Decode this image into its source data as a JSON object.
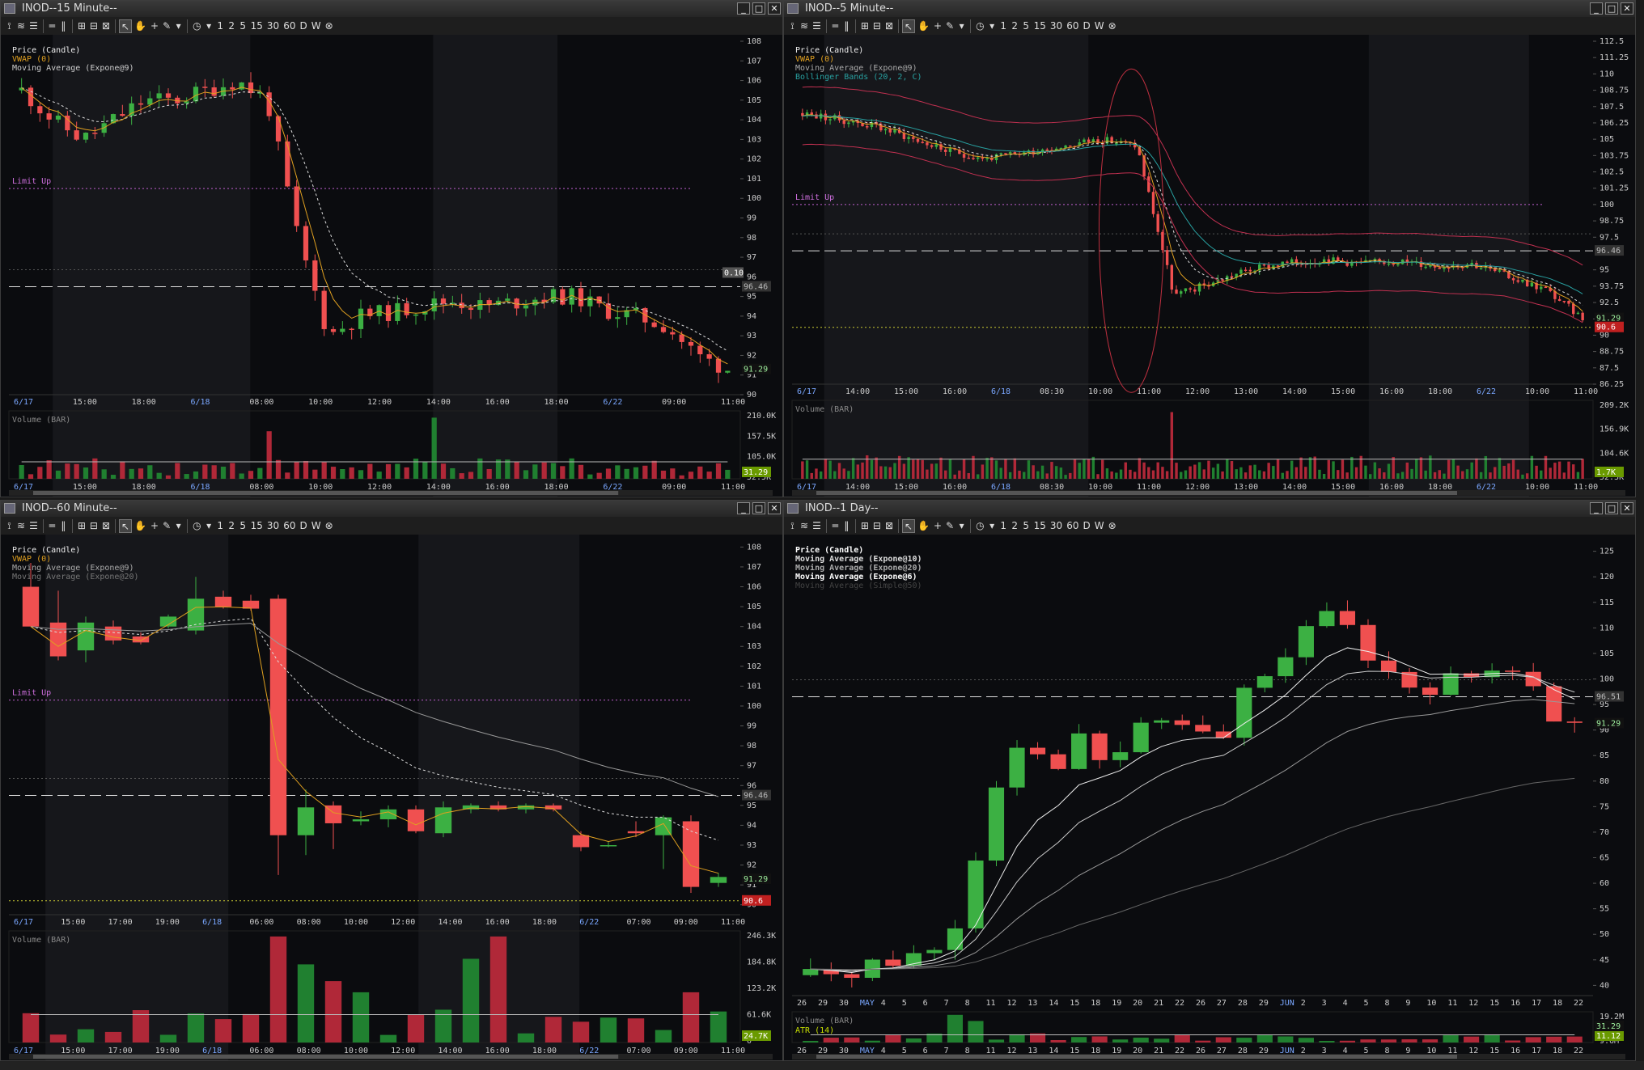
{
  "windows": [
    {
      "id": "w15",
      "title": "INOD--15 Minute--",
      "labels": [
        "Price (Candle)",
        "VWAP (0)",
        "Moving Average (Expone@9)"
      ],
      "limit_label": "Limit Up",
      "y_ticks": [
        "108",
        "107",
        "106",
        "105",
        "104",
        "103",
        "102",
        "101",
        "100",
        "99",
        "98",
        "97",
        "96",
        "95",
        "94",
        "93",
        "92",
        "91",
        "90"
      ],
      "x_ticks": [
        "6/17",
        "15:00",
        "18:00",
        "6/18",
        "08:00",
        "10:00",
        "12:00",
        "14:00",
        "16:00",
        "18:00",
        "6/22",
        "09:00",
        "11:00"
      ],
      "vol_label": "Volume (BAR)",
      "vol_ticks": [
        "210.0K",
        "157.5K",
        "105.0K",
        "52.5K"
      ],
      "badges": {
        "last": "91.29",
        "ref": "96.46",
        "crosshair": "0.10",
        "vol": "31.29"
      }
    },
    {
      "id": "w5",
      "title": "INOD--5 Minute--",
      "labels": [
        "Price (Candle)",
        "VWAP (0)",
        "Moving Average (Expone@9)",
        "Bollinger Bands (20, 2, C)"
      ],
      "limit_label": "Limit Up",
      "y_ticks": [
        "112.5",
        "111.25",
        "110",
        "108.75",
        "107.5",
        "106.25",
        "105",
        "103.75",
        "102.5",
        "101.25",
        "100",
        "98.75",
        "97.5",
        "95",
        "93.75",
        "92.5",
        "91.25",
        "90",
        "88.75",
        "87.5",
        "86.25"
      ],
      "x_ticks": [
        "6/17",
        "14:00",
        "15:00",
        "16:00",
        "6/18",
        "08:30",
        "10:00",
        "11:00",
        "12:00",
        "13:00",
        "14:00",
        "15:00",
        "16:00",
        "18:00",
        "6/22",
        "10:00",
        "11:00"
      ],
      "vol_label": "Volume (BAR)",
      "vol_ticks": [
        "209.2K",
        "156.9K",
        "104.6K",
        "52.3K"
      ],
      "badges": {
        "last": "91.29",
        "ref": "96.46",
        "low": "90.6",
        "vol": "1.7K"
      }
    },
    {
      "id": "w60",
      "title": "INOD--60 Minute--",
      "labels": [
        "Price (Candle)",
        "VWAP (0)",
        "Moving Average (Expone@9)",
        "Moving Average (Expone@20)"
      ],
      "limit_label": "Limit Up",
      "y_ticks": [
        "108",
        "107",
        "106",
        "105",
        "104",
        "103",
        "102",
        "101",
        "100",
        "99",
        "98",
        "97",
        "96",
        "95",
        "94",
        "93",
        "92",
        "91",
        "90"
      ],
      "x_ticks": [
        "6/17",
        "15:00",
        "17:00",
        "19:00",
        "6/18",
        "06:00",
        "08:00",
        "10:00",
        "12:00",
        "14:00",
        "16:00",
        "18:00",
        "6/22",
        "07:00",
        "09:00",
        "11:00"
      ],
      "vol_label": "Volume (BAR)",
      "vol_ticks": [
        "246.3K",
        "184.8K",
        "123.2K",
        "61.6K",
        "0"
      ],
      "badges": {
        "last": "91.29",
        "ref": "96.46",
        "low": "90.6",
        "vol": "24.7K"
      }
    },
    {
      "id": "wd",
      "title": "INOD--1 Day--",
      "labels": [
        "Price (Candle)",
        "Moving Average (Expone@10)",
        "Moving Average (Expone@20)",
        "Moving Average (Expone@6)",
        "Moving Average (Simple@50)"
      ],
      "y_ticks": [
        "125",
        "120",
        "115",
        "110",
        "105",
        "100",
        "95",
        "90",
        "85",
        "80",
        "75",
        "70",
        "65",
        "60",
        "55",
        "50",
        "45",
        "40"
      ],
      "x_ticks": [
        "26",
        "29",
        "30",
        "MAY",
        "4",
        "5",
        "6",
        "7",
        "8",
        "11",
        "12",
        "13",
        "14",
        "15",
        "18",
        "19",
        "20",
        "21",
        "22",
        "26",
        "27",
        "28",
        "29",
        "JUN",
        "2",
        "3",
        "4",
        "5",
        "8",
        "9",
        "10",
        "11",
        "12",
        "15",
        "16",
        "17",
        "18",
        "22"
      ],
      "vol_label": "Volume (BAR)",
      "atr_label": "ATR (14)",
      "vol_ticks": [
        "19.2M",
        "9.6M"
      ],
      "badges": {
        "last": "91.29",
        "ref": "96.51",
        "vol": "11.12",
        "atr": "31.29"
      }
    }
  ],
  "toolbar": {
    "items": [
      "1",
      "2",
      "5",
      "15",
      "30",
      "60",
      "D",
      "W"
    ]
  },
  "chart_data": [
    {
      "type": "candlestick",
      "title": "INOD--15 Minute--",
      "ylim": [
        90,
        108
      ],
      "key_levels": {
        "last": 91.29,
        "reference": 96.46
      },
      "close_path_approx": [
        105.5,
        104,
        103,
        104,
        105,
        105,
        105.5,
        106,
        105,
        98,
        93,
        94,
        94.2,
        94.5,
        94.8,
        94.5,
        94.7,
        95,
        95,
        94.3,
        94,
        93.5,
        92,
        91.3
      ]
    },
    {
      "type": "candlestick",
      "title": "INOD--5 Minute--",
      "ylim": [
        86.25,
        112.5
      ],
      "key_levels": {
        "last": 91.29,
        "reference": 96.46,
        "low": 90.6
      },
      "close_path_approx": [
        107,
        106.5,
        106,
        105,
        104,
        103.5,
        104,
        104.5,
        105,
        104.5,
        93,
        94,
        95,
        95.5,
        95.8,
        95.5,
        95.7,
        95.3,
        95.5,
        94.5,
        93.5,
        91.3
      ]
    },
    {
      "type": "candlestick",
      "title": "INOD--60 Minute--",
      "ylim": [
        90,
        108
      ],
      "candles": [
        {
          "o": 106,
          "h": 107.2,
          "l": 104,
          "c": 104,
          "d": "down"
        },
        {
          "o": 104.2,
          "h": 105.8,
          "l": 102.3,
          "c": 102.5,
          "d": "down"
        },
        {
          "o": 102.8,
          "h": 104.5,
          "l": 102.2,
          "c": 104.2,
          "d": "up"
        },
        {
          "o": 104,
          "h": 104.3,
          "l": 103.1,
          "c": 103.3,
          "d": "down"
        },
        {
          "o": 103.5,
          "h": 103.7,
          "l": 103.1,
          "c": 103.2,
          "d": "down"
        },
        {
          "o": 104,
          "h": 104.6,
          "l": 103.9,
          "c": 104.5,
          "d": "up"
        },
        {
          "o": 103.8,
          "h": 106.5,
          "l": 103.6,
          "c": 105.4,
          "d": "up"
        },
        {
          "o": 105.5,
          "h": 105.8,
          "l": 104.9,
          "c": 105,
          "d": "down"
        },
        {
          "o": 105.3,
          "h": 105.6,
          "l": 104.8,
          "c": 104.9,
          "d": "down"
        },
        {
          "o": 105.4,
          "h": 105.6,
          "l": 91.5,
          "c": 93.5,
          "d": "down"
        },
        {
          "o": 93.5,
          "h": 95.8,
          "l": 92.5,
          "c": 94.9,
          "d": "up"
        },
        {
          "o": 95,
          "h": 95.2,
          "l": 92.8,
          "c": 94.1,
          "d": "down"
        },
        {
          "o": 94.2,
          "h": 94.7,
          "l": 94,
          "c": 94.3,
          "d": "up"
        },
        {
          "o": 94.3,
          "h": 95,
          "l": 93.9,
          "c": 94.8,
          "d": "up"
        },
        {
          "o": 94.8,
          "h": 95,
          "l": 93.6,
          "c": 93.7,
          "d": "down"
        },
        {
          "o": 93.6,
          "h": 95.2,
          "l": 93.4,
          "c": 94.9,
          "d": "up"
        },
        {
          "o": 94.8,
          "h": 95.1,
          "l": 94.6,
          "c": 95,
          "d": "up"
        },
        {
          "o": 95,
          "h": 95.2,
          "l": 94.7,
          "c": 94.8,
          "d": "down"
        },
        {
          "o": 94.8,
          "h": 95.1,
          "l": 94.6,
          "c": 95,
          "d": "up"
        },
        {
          "o": 95,
          "h": 95.1,
          "l": 94.7,
          "c": 94.8,
          "d": "down"
        },
        {
          "o": 93.5,
          "h": 93.7,
          "l": 92.7,
          "c": 92.9,
          "d": "down"
        },
        {
          "o": 93,
          "h": 93.2,
          "l": 92.9,
          "c": 93,
          "d": "up"
        },
        {
          "o": 93.7,
          "h": 94.2,
          "l": 93.4,
          "c": 93.6,
          "d": "down"
        },
        {
          "o": 93.5,
          "h": 94.5,
          "l": 91.8,
          "c": 94.4,
          "d": "up"
        },
        {
          "o": 94.2,
          "h": 94.5,
          "l": 90.6,
          "c": 90.9,
          "d": "down"
        },
        {
          "o": 91.1,
          "h": 91.6,
          "l": 90.9,
          "c": 91.4,
          "d": "up"
        }
      ],
      "key_levels": {
        "last": 91.29,
        "reference": 96.46,
        "low": 90.6
      }
    },
    {
      "type": "candlestick",
      "title": "INOD--1 Day--",
      "ylim": [
        40,
        125
      ],
      "key_levels": {
        "last": 91.29,
        "reference": 96.51
      },
      "close_path_approx": [
        42,
        42,
        43,
        44,
        45,
        46,
        47,
        52,
        65,
        80,
        88,
        85,
        84,
        88,
        84,
        86,
        90,
        92,
        91,
        90,
        88,
        98,
        100,
        105,
        109,
        112,
        110,
        103,
        102,
        100,
        98,
        102,
        100,
        101,
        100,
        98,
        92,
        91.3
      ]
    }
  ]
}
